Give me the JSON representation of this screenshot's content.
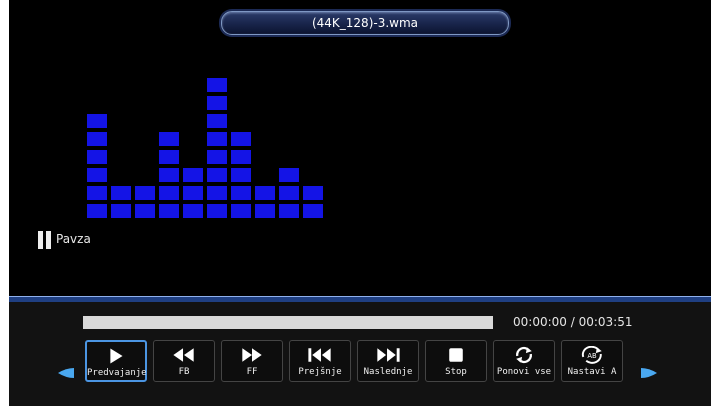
{
  "title_bar": {
    "file_name": "(44K_128)-3.wma"
  },
  "spectrum": {
    "levels": [
      6,
      2,
      2,
      5,
      3,
      8,
      5,
      2,
      3,
      2
    ],
    "color": "#1414e6"
  },
  "status": {
    "label": "Pavza"
  },
  "playback": {
    "progress": 0.0,
    "time": "00:00:00 / 00:03:51"
  },
  "controls": [
    {
      "label": "Predvajanje",
      "icon": "play-icon",
      "active": true
    },
    {
      "label": "FB",
      "icon": "fast-backward-icon",
      "active": false
    },
    {
      "label": "FF",
      "icon": "fast-forward-icon",
      "active": false
    },
    {
      "label": "Prejšnje",
      "icon": "skip-previous-icon",
      "active": false
    },
    {
      "label": "Naslednje",
      "icon": "skip-next-icon",
      "active": false
    },
    {
      "label": "Stop",
      "icon": "stop-icon",
      "active": false
    },
    {
      "label": "Ponovi vse",
      "icon": "repeat-all-icon",
      "active": false
    },
    {
      "label": "Nastavi A",
      "icon": "repeat-ab-icon",
      "active": false
    }
  ],
  "nav": {
    "left": "arrow-left-icon",
    "right": "arrow-right-icon"
  },
  "colors": {
    "accent": "#4b95e2",
    "bars": "#1414e6",
    "progress_track": "#d9d9d9"
  }
}
